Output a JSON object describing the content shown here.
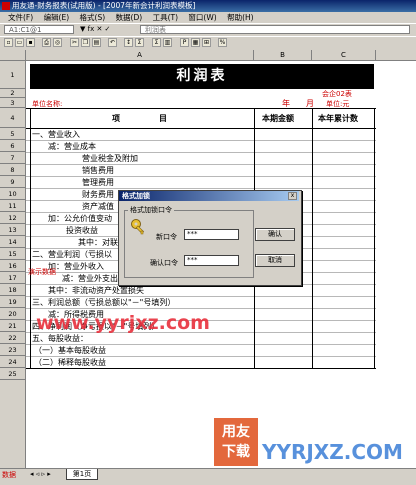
{
  "window": {
    "title": "用友通-财务报表(试用版) - [2007年新会计利润表模板]"
  },
  "menu": [
    "文件(F)",
    "编辑(E)",
    "格式(S)",
    "数据(D)",
    "工具(T)",
    "窗口(W)",
    "帮助(H)"
  ],
  "formula_bar": {
    "cell_ref": "A1:C1@1",
    "input": "利润表"
  },
  "toolbar": [
    "新建",
    "打开",
    "保存",
    "打印",
    "预览",
    "剪切",
    "复制",
    "粘贴",
    "撤销",
    "排序",
    "求和",
    "Σ",
    "图表",
    "P",
    "格式",
    "比例",
    "%?"
  ],
  "columns": [
    "A",
    "B",
    "C"
  ],
  "sheet": {
    "title": "利润表",
    "template_no": "会企02表",
    "unit_name_label": "单位名称:",
    "year_label": "年",
    "month_label": "月",
    "unit_label": "单位:元",
    "header_item": "项              目",
    "header_current": "本期金额",
    "header_accum": "本年累计数",
    "rows": [
      {
        "n": "1"
      },
      {
        "n": "2"
      },
      {
        "n": "3"
      },
      {
        "n": "4"
      },
      {
        "n": "5",
        "text": "一、营业收入"
      },
      {
        "n": "6",
        "text": "减：营业成本"
      },
      {
        "n": "7",
        "text": "营业税金及附加"
      },
      {
        "n": "8",
        "text": "销售费用"
      },
      {
        "n": "9",
        "text": "管理费用"
      },
      {
        "n": "10",
        "text": "财务费用"
      },
      {
        "n": "11",
        "text": "资产减值"
      },
      {
        "n": "12",
        "text": "加：公允价值变动"
      },
      {
        "n": "13",
        "text": "投资收益"
      },
      {
        "n": "14",
        "text": "其中：对联"
      },
      {
        "n": "15",
        "text": "二、营业利润（亏损以"
      },
      {
        "n": "16",
        "text": "加：营业外收入"
      },
      {
        "n": "17",
        "text": "减：营业外支出"
      },
      {
        "n": "18",
        "text": "其中：非流动资产处置损失"
      },
      {
        "n": "19",
        "text": "三、利润总额（亏损总额以\"－\"号填列）"
      },
      {
        "n": "20",
        "text": "减：所得税费用"
      },
      {
        "n": "21",
        "text": "四、净利润（净亏损以\"－\"号填列）"
      },
      {
        "n": "22",
        "text": "五、每股收益："
      },
      {
        "n": "23",
        "text": "（一）基本每股收益"
      },
      {
        "n": "24",
        "text": "（二）稀释每股收益"
      },
      {
        "n": "25"
      }
    ],
    "side_note": "演示数据"
  },
  "dialog": {
    "title": "格式加锁",
    "group_label": "格式加锁口令",
    "password_label": "新口令",
    "password_value": "***",
    "confirm_label": "确认口令",
    "confirm_value": "***",
    "ok": "确认",
    "cancel": "取消",
    "close": "x"
  },
  "tabs": {
    "status": "数据",
    "sheet1": "第1页"
  },
  "watermark": {
    "url": "www.yyrjxz.com",
    "logo_line1": "用友",
    "logo_line2": "下载",
    "brand": "YYRJXZ.COM"
  }
}
